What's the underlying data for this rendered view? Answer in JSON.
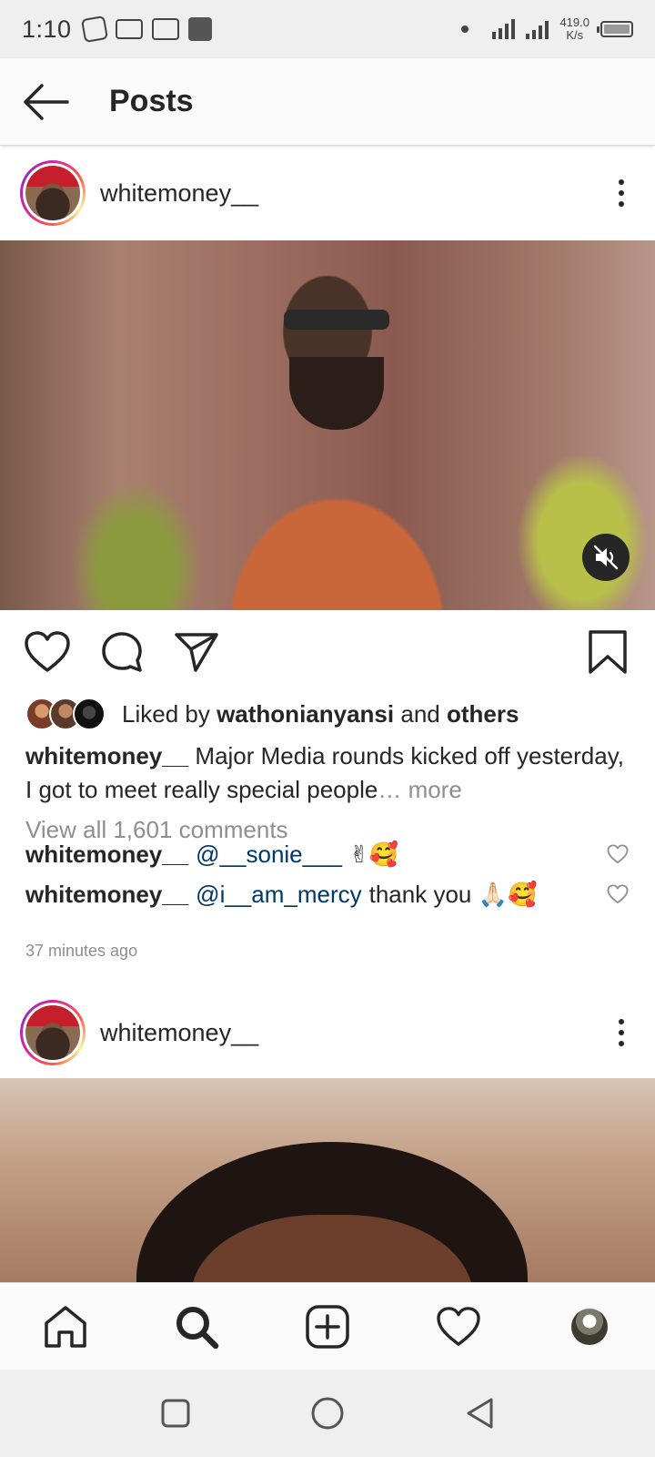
{
  "status_bar": {
    "time": "1:10",
    "speed_value": "419.0",
    "speed_unit": "K/s",
    "network": "3G"
  },
  "header": {
    "title": "Posts",
    "back_icon": "arrow-left-icon"
  },
  "posts": [
    {
      "username": "whitemoney__",
      "media_type": "video",
      "liked_by_prefix": "Liked by",
      "liked_by_user": "wathonianyansi",
      "liked_by_and": "and",
      "liked_by_others": "others",
      "caption_user": "whitemoney__",
      "caption_text": "Major Media rounds kicked off yesterday, I got to meet really special people",
      "caption_more": "… more",
      "view_all_comments": "View all 1,601 comments",
      "comments": [
        {
          "user": "whitemoney__",
          "mention": "@__sonie___",
          "text": "✌🥰"
        },
        {
          "user": "whitemoney__",
          "mention": "@i__am_mercy",
          "text": "thank you 🙏🏻🥰"
        }
      ],
      "timestamp": "37 minutes ago"
    },
    {
      "username": "whitemoney__",
      "media_type": "image"
    }
  ],
  "bottom_nav": [
    "home-icon",
    "search-icon",
    "new-post-icon",
    "activity-heart-icon",
    "profile-avatar"
  ],
  "colors": {
    "link": "#00376b",
    "secondary_text": "#8e8e8e",
    "primary_text": "#262626"
  }
}
